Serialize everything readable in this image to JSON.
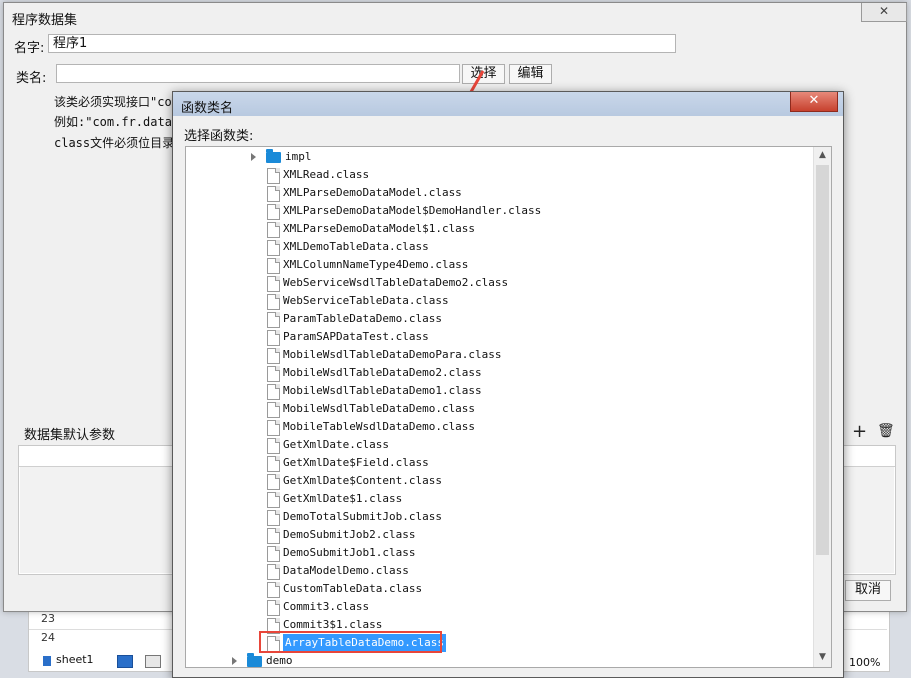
{
  "main_dialog": {
    "title": "程序数据集",
    "close": "✕",
    "name_label": "名字:",
    "name_value": "程序1",
    "class_label": "类名:",
    "class_value": "",
    "select_button": "选择",
    "edit_button": "编辑",
    "notes": [
      "该类必须实现接口\"com",
      "例如:\"com.fr.data.im",
      "class文件必须位目录W"
    ],
    "params_label": "数据集默认参数",
    "add_icon": "+",
    "delete_icon": "🗑",
    "cancel_button": "取消"
  },
  "background_sheet": {
    "row_23": "23",
    "row_24": "24",
    "sheet_tab": "sheet1",
    "zoom": "100%"
  },
  "function_dialog": {
    "title": "函数类名",
    "close": "✕",
    "subtitle": "选择函数类:",
    "tree": {
      "impl_folder": "impl",
      "files": [
        "XMLRead.class",
        "XMLParseDemoDataModel.class",
        "XMLParseDemoDataModel$DemoHandler.class",
        "XMLParseDemoDataModel$1.class",
        "XMLDemoTableData.class",
        "XMLColumnNameType4Demo.class",
        "WebServiceWsdlTableDataDemo2.class",
        "WebServiceTableData.class",
        "ParamTableDataDemo.class",
        "ParamSAPDataTest.class",
        "MobileWsdlTableDataDemoPara.class",
        "MobileWsdlTableDataDemo2.class",
        "MobileWsdlTableDataDemo1.class",
        "MobileWsdlTableDataDemo.class",
        "MobileTableWsdlDataDemo.class",
        "GetXmlDate.class",
        "GetXmlDate$Field.class",
        "GetXmlDate$Content.class",
        "GetXmlDate$1.class",
        "DemoTotalSubmitJob.class",
        "DemoSubmitJob2.class",
        "DemoSubmitJob1.class",
        "DataModelDemo.class",
        "CustomTableData.class",
        "Commit3.class",
        "Commit3$1.class"
      ],
      "selected_file": "ArrayTableDataDemo.class",
      "demo_folder": "demo"
    }
  },
  "colors": {
    "selection": "#3399ff",
    "highlight_border": "#e8463a",
    "folder": "#1a8ad8",
    "close_button": "#c7412e"
  }
}
